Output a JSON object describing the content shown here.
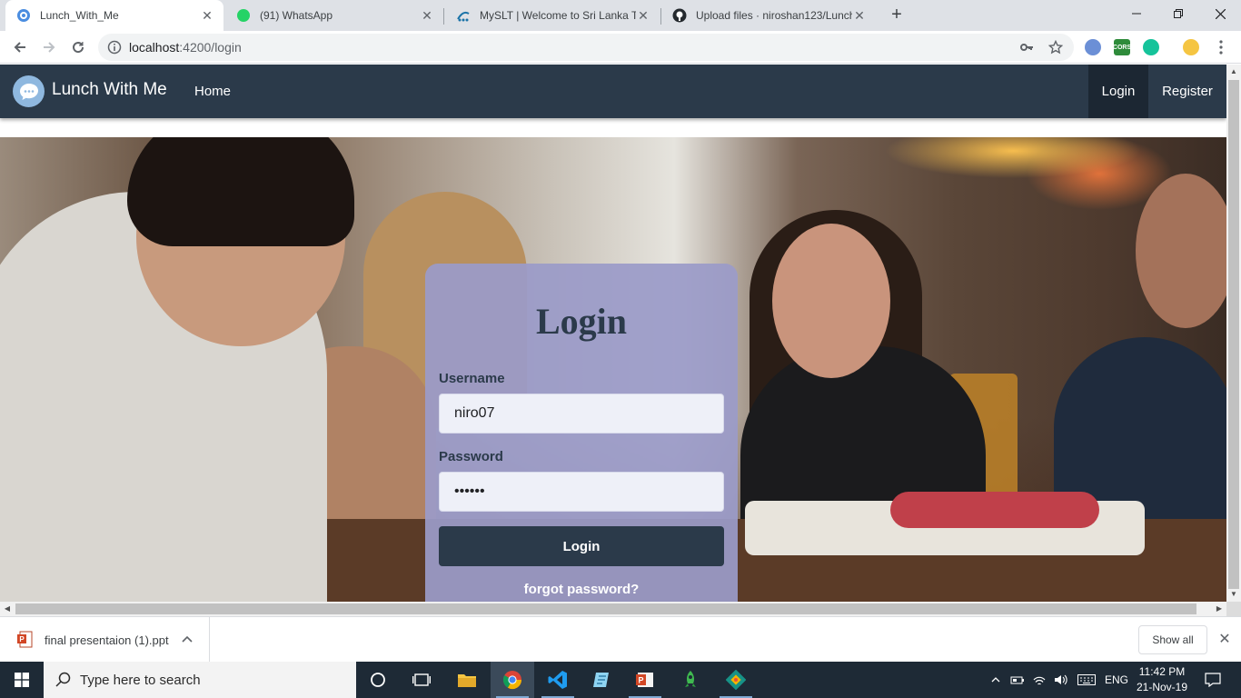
{
  "browser": {
    "tabs": [
      {
        "title": "Lunch_With_Me",
        "active": true,
        "icon": "globe-icon"
      },
      {
        "title": "(91) WhatsApp",
        "active": false,
        "icon": "whatsapp-icon",
        "badge": "91"
      },
      {
        "title": "MySLT | Welcome to Sri Lanka Te",
        "active": false,
        "icon": "slt-icon"
      },
      {
        "title": "Upload files · niroshan123/Lunch",
        "active": false,
        "icon": "github-icon"
      }
    ],
    "new_tab": "+",
    "address": {
      "host": "localhost",
      "path": ":4200/login"
    },
    "extension_labels": {
      "cors": "CORS"
    }
  },
  "app": {
    "brand": "Lunch With Me",
    "nav": {
      "home": "Home",
      "login": "Login",
      "register": "Register"
    },
    "login_form": {
      "title": "Login",
      "username_label": "Username",
      "username_value": "niro07",
      "password_label": "Password",
      "password_value": "••••••",
      "submit_label": "Login",
      "forgot_label": "forgot password?"
    },
    "colors": {
      "navbar": "#2b3a4a",
      "card": "#9b9bc8",
      "button": "#2b3a4a"
    }
  },
  "downloads": {
    "items": [
      {
        "name": "final presentaion (1).ppt",
        "icon": "ppt-file-icon"
      }
    ],
    "show_all": "Show all"
  },
  "taskbar": {
    "search_placeholder": "Type here to search",
    "language": "ENG",
    "time": "11:42 PM",
    "date": "21-Nov-19"
  }
}
